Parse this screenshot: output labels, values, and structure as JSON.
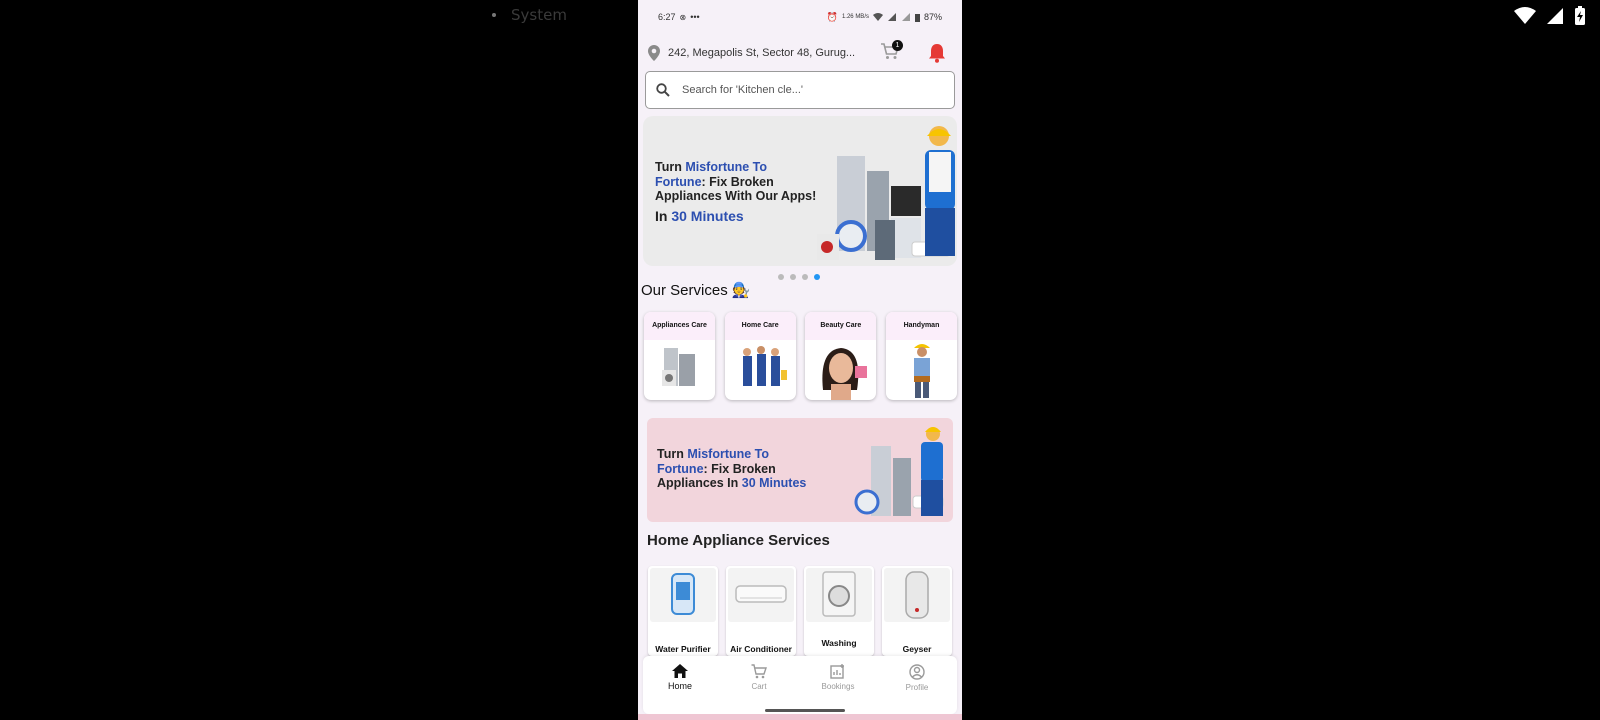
{
  "system_overlay": {
    "label": "System"
  },
  "status_bar": {
    "time": "6:27",
    "battery": "87%",
    "speed": "1.26 MB/s"
  },
  "header": {
    "address": "242, Megapolis St, Sector 48, Gurug...",
    "cart_count": "1"
  },
  "search": {
    "placeholder": "Search for 'Kitchen cle...'"
  },
  "hero_banner": {
    "line1_a": "Turn ",
    "line1_b": "Misfortune To",
    "line2_a": "Fortune",
    "line2_b": ": Fix Broken",
    "line3": "Appliances With Our Apps!",
    "line4_a": "In ",
    "line4_b": "30 Minutes",
    "active_slide": 4,
    "total_slides": 4
  },
  "services": {
    "title": "Our Services 🧑‍🔧",
    "items": [
      {
        "label": "Appliances Care"
      },
      {
        "label": "Home Care"
      },
      {
        "label": "Beauty Care"
      },
      {
        "label": "Handyman"
      }
    ]
  },
  "promo_banner": {
    "line1_a": "Turn ",
    "line1_b": "Misfortune To",
    "line2_a": "Fortune",
    "line2_b": ": Fix Broken",
    "line3_a": "Appliances In ",
    "line3_b": "30 Minutes"
  },
  "home_appliances": {
    "title": "Home Appliance Services",
    "items": [
      {
        "label": "Water Purifier"
      },
      {
        "label": "Air Conditioner"
      },
      {
        "label": "Washing"
      },
      {
        "label": "Geyser"
      }
    ]
  },
  "bottom_nav": {
    "items": [
      {
        "label": "Home",
        "icon": "home-icon"
      },
      {
        "label": "Cart",
        "icon": "cart-icon"
      },
      {
        "label": "Bookings",
        "icon": "bookings-icon"
      },
      {
        "label": "Profile",
        "icon": "profile-icon"
      }
    ]
  },
  "colors": {
    "accent_blue": "#2c4fb0",
    "bell_red": "#e53935",
    "dot_active": "#2196f3"
  }
}
